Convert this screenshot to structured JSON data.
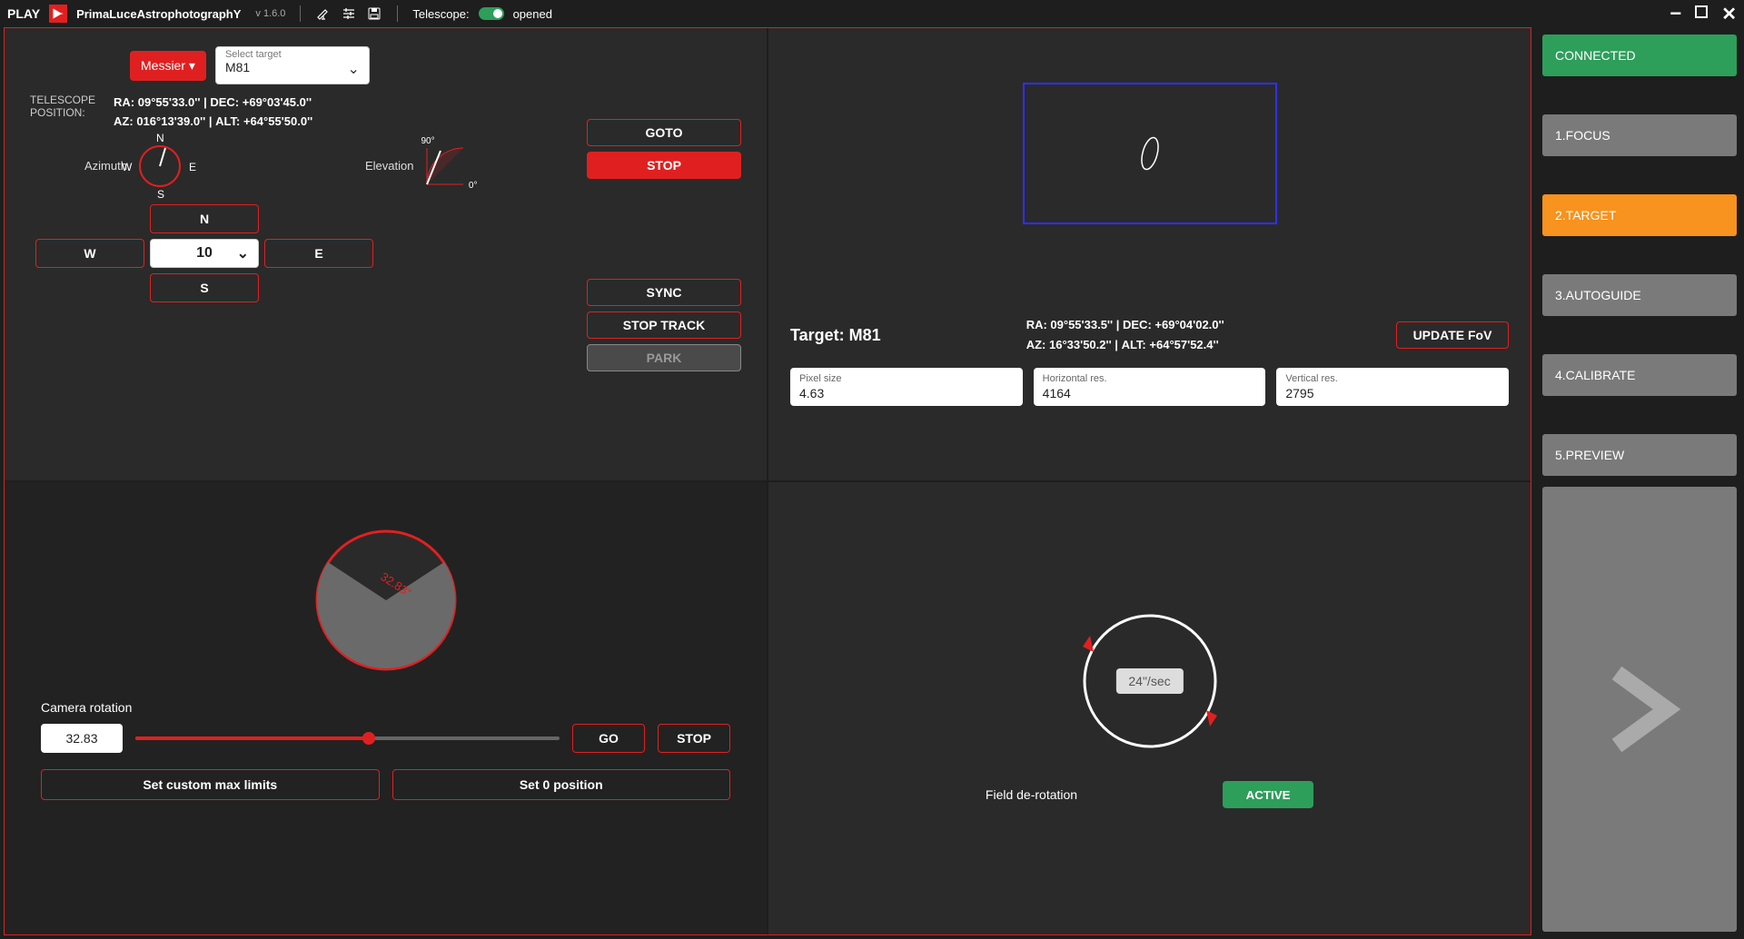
{
  "topbar": {
    "play": "PLAY",
    "app_name_1": "P",
    "app_name_2": "rima",
    "app_name_3": "L",
    "app_name_4": "uce",
    "app_name_5": "A",
    "app_name_6": "strophotograph",
    "app_name_7": "Y",
    "version": "v 1.6.0",
    "telescope_label": "Telescope:",
    "status": "opened"
  },
  "sidebar": {
    "connected": "CONNECTED",
    "items": [
      "1.FOCUS",
      "2.TARGET",
      "3.AUTOGUIDE",
      "4.CALIBRATE",
      "5.PREVIEW"
    ],
    "active_index": 1
  },
  "telescope": {
    "catalog_btn": "Messier",
    "target_placeholder": "Select target",
    "target_value": "M81",
    "goto": "GOTO",
    "stop": "STOP",
    "position_label_1": "TELESCOPE",
    "position_label_2": "POSITION:",
    "ra_label": "RA:",
    "ra_value": "09°55'33.0''",
    "dec_label": "DEC:",
    "dec_value": "+69°03'45.0''",
    "az_label": "AZ:",
    "az_value": "016°13'39.0''",
    "alt_label": "ALT:",
    "alt_value": "+64°55'50.0''",
    "sep": " | ",
    "azimuth": "Azimuth",
    "elevation": "Elevation",
    "compass": {
      "n": "N",
      "s": "S",
      "e": "E",
      "w": "W"
    },
    "elev_90": "90°",
    "elev_0": "0°",
    "dir_n": "N",
    "dir_w": "W",
    "dir_e": "E",
    "dir_s": "S",
    "slew_rate": "10",
    "sync": "SYNC",
    "stop_track": "STOP TRACK",
    "park": "PARK"
  },
  "target": {
    "title_prefix": "Target: ",
    "name": "M81",
    "ra_label": "RA:",
    "ra_value": "09°55'33.5''",
    "dec_label": "DEC:",
    "dec_value": "+69°04'02.0''",
    "az_label": "AZ:",
    "az_value": "16°33'50.2''",
    "alt_label": "ALT:",
    "alt_value": "+64°57'52.4''",
    "sep": " | ",
    "update_fov": "UPDATE FoV",
    "fields": {
      "pixel_size": {
        "label": "Pixel size",
        "value": "4.63"
      },
      "hres": {
        "label": "Horizontal res.",
        "value": "4164"
      },
      "vres": {
        "label": "Vertical res.",
        "value": "2795"
      }
    }
  },
  "rotation": {
    "angle_label": "32.83°",
    "title": "Camera rotation",
    "value": "32.83",
    "go": "GO",
    "stop": "STOP",
    "set_limits": "Set custom max limits",
    "set_zero": "Set 0 position"
  },
  "derotation": {
    "speed": "24\"/sec",
    "label": "Field de-rotation",
    "active": "ACTIVE"
  }
}
